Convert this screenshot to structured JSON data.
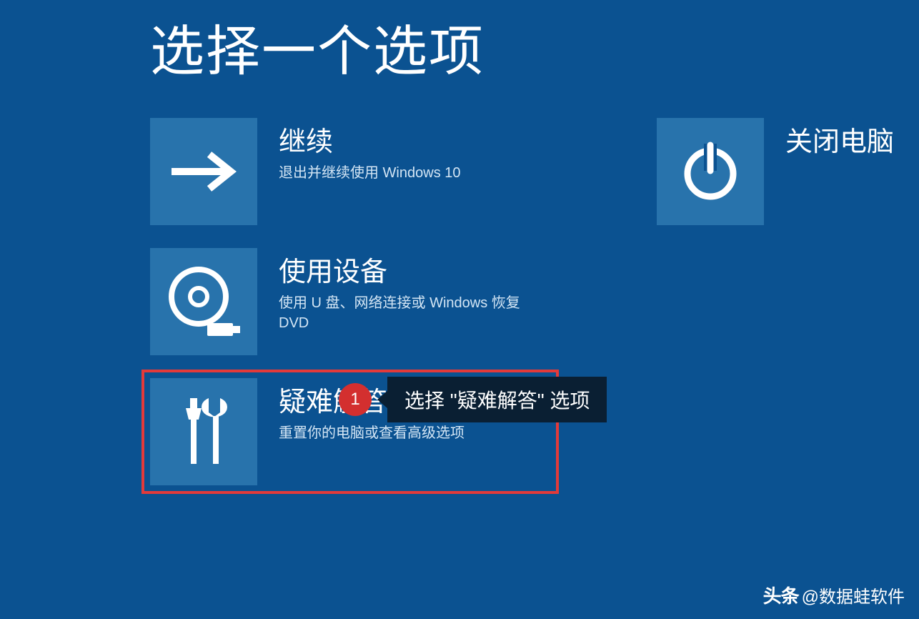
{
  "page": {
    "title": "选择一个选项"
  },
  "options": {
    "continue": {
      "title": "继续",
      "desc": "退出并继续使用 Windows 10"
    },
    "use_device": {
      "title": "使用设备",
      "desc": "使用 U 盘、网络连接或 Windows 恢复DVD"
    },
    "troubleshoot": {
      "title": "疑难解答",
      "desc": "重置你的电脑或查看高级选项"
    },
    "shutdown": {
      "title": "关闭电脑"
    }
  },
  "callout": {
    "number": "1",
    "text": "选择 \"疑难解答\" 选项"
  },
  "watermark": {
    "logo": "头条",
    "text": "@数据蛙软件"
  }
}
